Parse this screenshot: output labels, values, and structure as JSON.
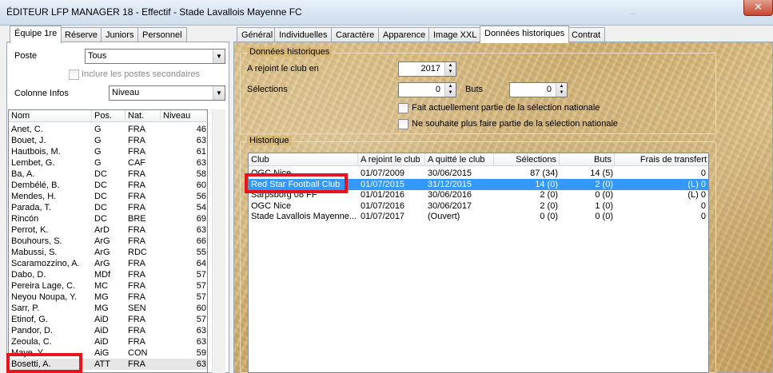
{
  "window": {
    "title": "ÉDITEUR LFP MANAGER 18 - Effectif - Stade Lavallois Mayenne FC",
    "faded_text": "...",
    "close_symbol": "✕"
  },
  "left_tabs": [
    "Équipe 1re",
    "Réserve",
    "Juniors",
    "Personnel"
  ],
  "right_tabs": [
    "Général",
    "Individuelles",
    "Caractère",
    "Apparence",
    "Image XXL",
    "Données historiques",
    "Contrat"
  ],
  "filters": {
    "poste_label": "Poste",
    "poste_value": "Tous",
    "secondary_label": "Inclure les postes secondaires",
    "colonne_label": "Colonne Infos",
    "colonne_value": "Niveau"
  },
  "players": {
    "headers": [
      "Nom",
      "Pos.",
      "Nat.",
      "Niveau"
    ],
    "rows": [
      [
        "Anet, C.",
        "G",
        "FRA",
        "46"
      ],
      [
        "Bouet, J.",
        "G",
        "FRA",
        "63"
      ],
      [
        "Hautbois, M.",
        "G",
        "FRA",
        "61"
      ],
      [
        "Lembet, G.",
        "G",
        "CAF",
        "63"
      ],
      [
        "Ba, A.",
        "DC",
        "FRA",
        "58"
      ],
      [
        "Dembélé, B.",
        "DC",
        "FRA",
        "60"
      ],
      [
        "Mendes, H.",
        "DC",
        "FRA",
        "56"
      ],
      [
        "Parada, T.",
        "DC",
        "FRA",
        "54"
      ],
      [
        "Rincón",
        "DC",
        "BRE",
        "69"
      ],
      [
        "Perrot, K.",
        "ArD",
        "FRA",
        "63"
      ],
      [
        "Bouhours, S.",
        "ArG",
        "FRA",
        "66"
      ],
      [
        "Mabussi, S.",
        "ArG",
        "RDC",
        "55"
      ],
      [
        "Scaramozzino, A.",
        "ArG",
        "FRA",
        "64"
      ],
      [
        "Dabo, D.",
        "MDf",
        "FRA",
        "57"
      ],
      [
        "Pereira Lage, C.",
        "MC",
        "FRA",
        "57"
      ],
      [
        "Neyou Noupa, Y.",
        "MG",
        "FRA",
        "57"
      ],
      [
        "Sarr, P.",
        "MG",
        "SEN",
        "60"
      ],
      [
        "Etinof, G.",
        "AiD",
        "FRA",
        "57"
      ],
      [
        "Pandor, D.",
        "AiD",
        "FRA",
        "63"
      ],
      [
        "Zeoula, C.",
        "AiD",
        "FRA",
        "63"
      ],
      [
        "Maye, Y.",
        "AiG",
        "CON",
        "59"
      ],
      [
        "Bosetti, A.",
        "ATT",
        "FRA",
        "63"
      ]
    ]
  },
  "historical": {
    "group_title": "Données historiques",
    "joined_label": "A rejoint le club en",
    "joined_value": "2017",
    "selections_label": "Sélections",
    "selections_value": "0",
    "buts_label": "Buts",
    "buts_value": "0",
    "current_national_label": "Fait actuellement partie de la sélection nationale",
    "no_longer_national_label": "Ne souhaite plus faire partie de la sélection nationale"
  },
  "history": {
    "group_title": "Historique",
    "headers": [
      "Club",
      "A rejoint le club",
      "A quitté le club",
      "Sélections",
      "Buts",
      "Frais de transfert"
    ],
    "rows": [
      [
        "OGC Nice",
        "01/07/2009",
        "30/06/2015",
        "87 (34)",
        "14 (5)",
        "0"
      ],
      [
        "Red Star Football Club",
        "01/07/2015",
        "31/12/2015",
        "14 (0)",
        "2 (0)",
        "(L) 0"
      ],
      [
        "Sarpsborg 08 FF",
        "01/01/2016",
        "30/06/2016",
        "2 (0)",
        "0 (0)",
        "(L) 0"
      ],
      [
        "OGC Nice",
        "01/07/2016",
        "30/06/2017",
        "2 (0)",
        "1 (0)",
        "0"
      ],
      [
        "Stade Lavallois Mayenne...",
        "01/07/2017",
        "(Ouvert)",
        "0 (0)",
        "0 (0)",
        "0"
      ]
    ]
  }
}
